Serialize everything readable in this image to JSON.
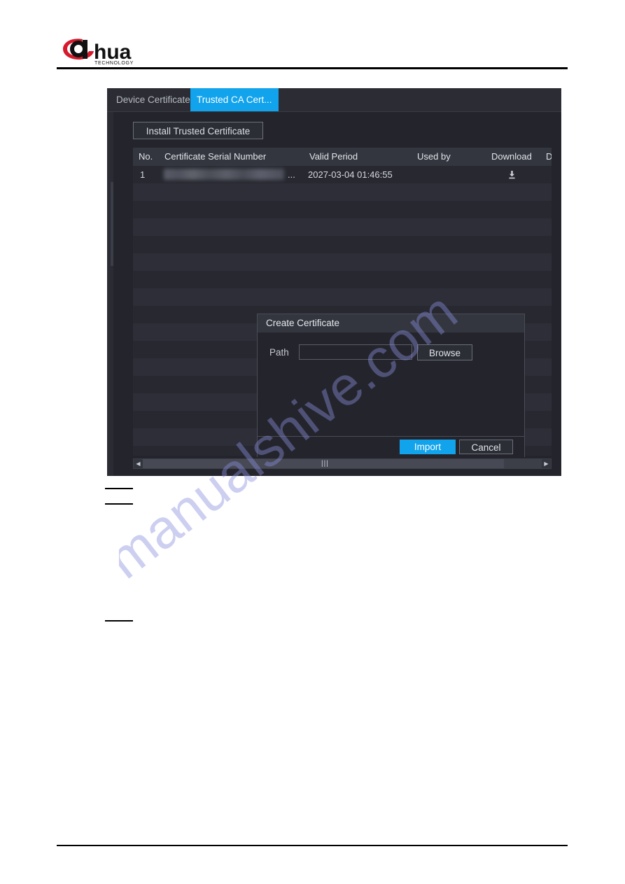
{
  "document": {
    "logo": {
      "brand": "alhua",
      "brand_display": "a",
      "wordmark": "hua",
      "tagline": "TECHNOLOGY",
      "accent_color": "#d7192c"
    }
  },
  "device_ui": {
    "tabs": [
      {
        "label": "Device Certificate",
        "active": false
      },
      {
        "label": "Trusted CA Cert...",
        "active": true
      }
    ],
    "toolbar": {
      "install_label": "Install Trusted Certificate"
    },
    "table": {
      "columns": [
        "No.",
        "Certificate Serial Number",
        "Valid Period",
        "Used by",
        "Download",
        "D"
      ],
      "rows": [
        {
          "no": "1",
          "serial": "",
          "serial_truncated": "...",
          "valid_period": "2027-03-04 01:46:55",
          "used_by": "",
          "download_icon": "download-icon"
        }
      ],
      "empty_row_count": 16
    },
    "scrollbar": {
      "left_arrow": "◀",
      "right_arrow": "▶",
      "grip": "|||"
    }
  },
  "dialog": {
    "title": "Create Certificate",
    "path_label": "Path",
    "path_value": "",
    "path_placeholder": "",
    "browse_label": "Browse",
    "import_label": "Import",
    "cancel_label": "Cancel"
  },
  "watermark": {
    "text": "manualshive.com",
    "color": "#8a8ee0"
  },
  "colors": {
    "accent_blue": "#11a3ec",
    "panel_bg": "#24252c",
    "header_bg": "#34363f",
    "logo_red": "#d7192c"
  }
}
